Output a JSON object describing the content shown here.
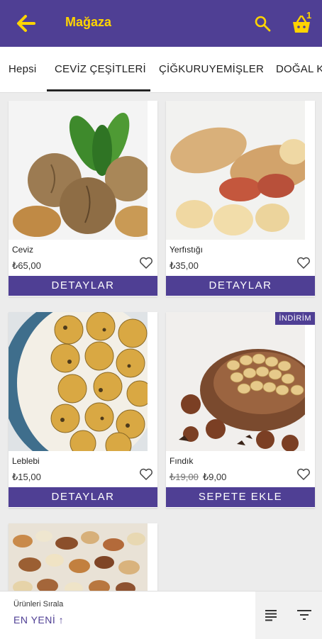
{
  "appbar": {
    "title": "Mağaza",
    "cart_count": "1"
  },
  "tabs": [
    {
      "label": "Hepsi"
    },
    {
      "label": "CEVİZ ÇEŞİTLERİ"
    },
    {
      "label": "ÇİĞKURUYEMİŞLER"
    },
    {
      "label": "DOĞAL K"
    }
  ],
  "products": [
    {
      "name": "Ceviz",
      "price": "₺65,00",
      "button": "DETAYLAR"
    },
    {
      "name": "Yerfıstığı",
      "price": "₺35,00",
      "button": "DETAYLAR"
    },
    {
      "name": "Leblebi",
      "price": "₺15,00",
      "button": "DETAYLAR"
    },
    {
      "name": "Fındık",
      "old_price": "₺19,00",
      "price": "₺9,00",
      "button": "SEPETE EKLE",
      "badge": "İNDİRİM"
    }
  ],
  "sort": {
    "title": "Ürünleri Sırala",
    "value": "EN YENİ"
  },
  "colors": {
    "primary": "#4f3f94",
    "accent": "#ffd400"
  }
}
